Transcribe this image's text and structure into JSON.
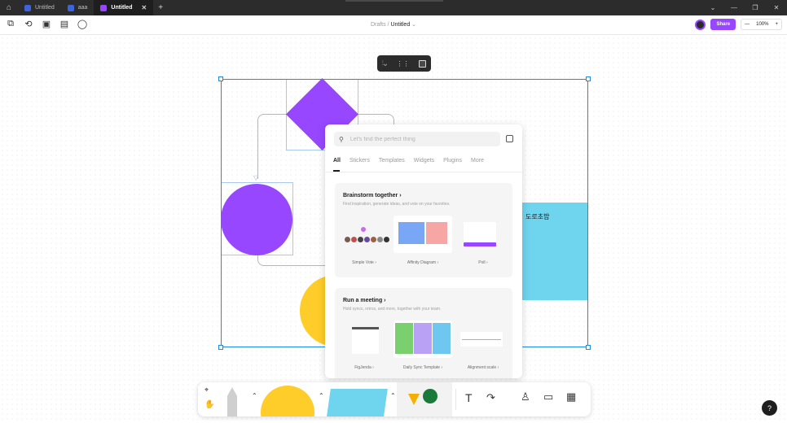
{
  "titlebar": {
    "tabs": [
      {
        "label": "Untitled"
      },
      {
        "label": "aaa"
      },
      {
        "label": "Untitled"
      }
    ],
    "new_tab": "+",
    "window_controls": [
      "⌄",
      "—",
      "❐",
      "✕"
    ]
  },
  "toolbar": {
    "breadcrumb_parent": "Drafts",
    "breadcrumb_sep": "/",
    "breadcrumb_current": "Untitled",
    "share_label": "Share",
    "zoom_minus": "—",
    "zoom_value": "100%",
    "zoom_plus": "+"
  },
  "canvas": {
    "sticky_text": "도로초밥"
  },
  "insert_panel": {
    "search_placeholder": "Let's find the perfect thing",
    "tabs": [
      "All",
      "Stickers",
      "Templates",
      "Widgets",
      "Plugins",
      "More"
    ],
    "sections": [
      {
        "title": "Brainstorm together ›",
        "description": "Find inspiration, generate ideas, and vote on your favorites.",
        "cards": [
          "Simple Vote ›",
          "Affinity Diagram ›",
          "Poll ›"
        ]
      },
      {
        "title": "Run a meeting ›",
        "description": "Hold syncs, retros, and more, together with your team.",
        "cards": [
          "FigJenda ›",
          "Daily Sync Template ›",
          "Alignment scale ›"
        ]
      }
    ]
  },
  "help_label": "?",
  "colors": {
    "accent_purple": "#9747ff",
    "selection_blue": "#1b8ce6",
    "sticky_cyan": "#6fd4ee",
    "shape_yellow": "#ffcd29"
  }
}
